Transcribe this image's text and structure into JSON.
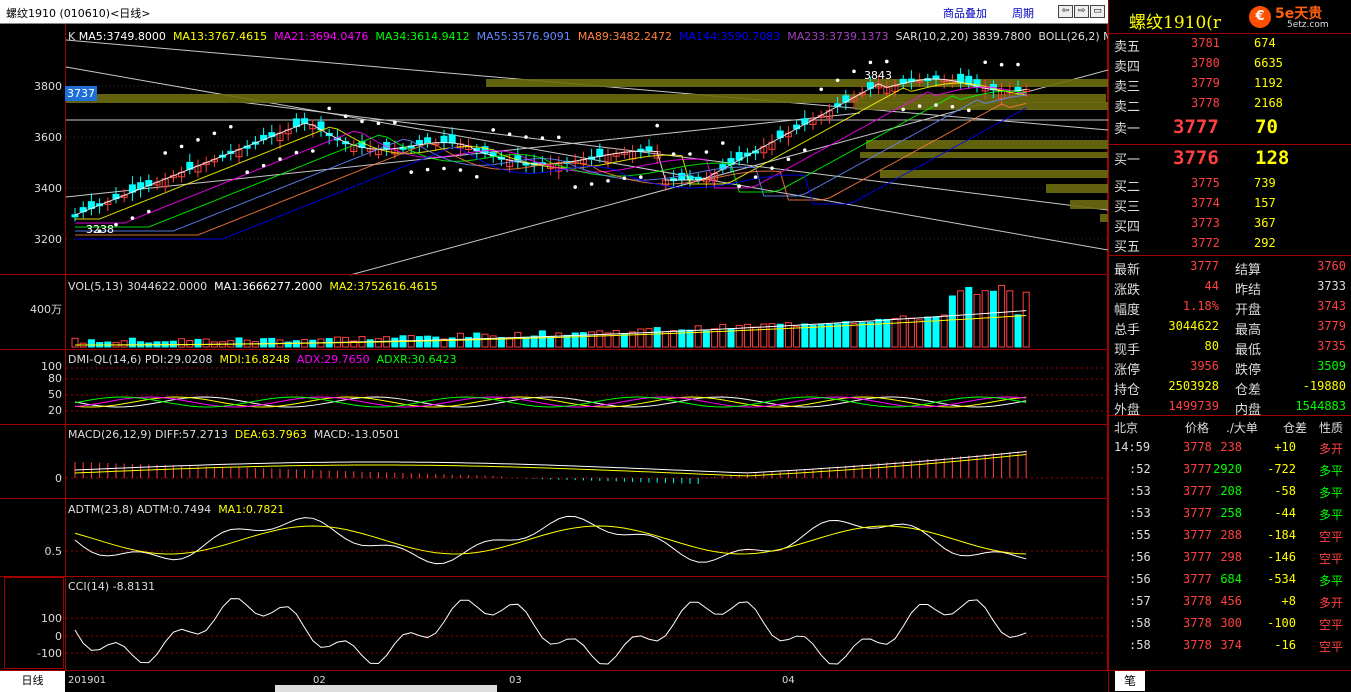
{
  "titlebar": {
    "title": "螺纹1910 (010610)<日线>",
    "overlay_btn": "商品叠加",
    "period_btn": "周期",
    "nav_buttons": [
      "⇦",
      "⇨",
      "▭"
    ]
  },
  "logo": {
    "text": "5e天贵",
    "sub": "5etz.com"
  },
  "main_panel": {
    "label_k": "K",
    "indicators": [
      {
        "text": "MA5:3749.8000",
        "color": "#ffffff"
      },
      {
        "text": "MA13:3767.4615",
        "color": "#ffff00"
      },
      {
        "text": "MA21:3694.0476",
        "color": "#ff00ff"
      },
      {
        "text": "MA34:3614.9412",
        "color": "#00ff00"
      },
      {
        "text": "MA55:3576.9091",
        "color": "#6688ff"
      },
      {
        "text": "MA89:3482.2472",
        "color": "#ff8040"
      },
      {
        "text": "MA144:3590.7083",
        "color": "#0000ff"
      },
      {
        "text": "MA233:3739.1373",
        "color": "#a040c0"
      },
      {
        "text": "SAR(10,2,20)  3839.7800",
        "color": "#dddddd"
      },
      {
        "text": "BOLL(26,2)  M",
        "color": "#dddddd"
      }
    ],
    "y_ticks": [
      "3800",
      "3600",
      "3400",
      "3200"
    ],
    "price_tag": "3737",
    "high_label": "3843",
    "low_label": "3238"
  },
  "vol_panel": {
    "indicators": [
      {
        "text": "VOL(5,13)  3044622.0000",
        "color": "#dddddd"
      },
      {
        "text": "MA1:3666277.2000",
        "color": "#ffffff"
      },
      {
        "text": "MA2:3752616.4615",
        "color": "#ffff00"
      }
    ],
    "y_ticks": [
      "400万"
    ]
  },
  "dmi_panel": {
    "indicators": [
      {
        "text": "DMI-QL(14,6)  PDI:29.0208",
        "color": "#dddddd"
      },
      {
        "text": "MDI:16.8248",
        "color": "#ffff00"
      },
      {
        "text": "ADX:29.7650",
        "color": "#ff00ff"
      },
      {
        "text": "ADXR:30.6423",
        "color": "#00ff00"
      }
    ],
    "y_ticks": [
      "100",
      "80",
      "50",
      "20"
    ]
  },
  "macd_panel": {
    "indicators": [
      {
        "text": "MACD(26,12,9)  DIFF:57.2713",
        "color": "#dddddd"
      },
      {
        "text": "DEA:63.7963",
        "color": "#ffff00"
      },
      {
        "text": "MACD:-13.0501",
        "color": "#dddddd"
      }
    ],
    "y_ticks": [
      "0"
    ]
  },
  "adtm_panel": {
    "indicators": [
      {
        "text": "ADTM(23,8)  ADTM:0.7494",
        "color": "#dddddd"
      },
      {
        "text": "MA1:0.7821",
        "color": "#ffff00"
      }
    ],
    "y_ticks": [
      "0.5"
    ]
  },
  "cci_panel": {
    "indicators": [
      {
        "text": "CCI(14)  -8.8131",
        "color": "#dddddd"
      }
    ],
    "y_ticks": [
      "100",
      "0",
      "-100"
    ]
  },
  "bottombar": {
    "period_tab": "日线",
    "dates": [
      "201901",
      "02",
      "03",
      "04"
    ]
  },
  "quote": {
    "title": "螺纹1910(r",
    "asks": [
      {
        "label": "卖五",
        "price": "3781",
        "vol": "674"
      },
      {
        "label": "卖四",
        "price": "3780",
        "vol": "6635"
      },
      {
        "label": "卖三",
        "price": "3779",
        "vol": "1192"
      },
      {
        "label": "卖二",
        "price": "3778",
        "vol": "2168"
      },
      {
        "label": "卖一",
        "price": "3777",
        "vol": "70"
      }
    ],
    "bids": [
      {
        "label": "买一",
        "price": "3776",
        "vol": "128"
      },
      {
        "label": "买二",
        "price": "3775",
        "vol": "739"
      },
      {
        "label": "买三",
        "price": "3774",
        "vol": "157"
      },
      {
        "label": "买四",
        "price": "3773",
        "vol": "367"
      },
      {
        "label": "买五",
        "price": "3772",
        "vol": "292"
      }
    ],
    "stats": [
      {
        "l1": "最新",
        "v1": "3777",
        "c1": "#ff4040",
        "l2": "结算",
        "v2": "3760",
        "c2": "#ff4040"
      },
      {
        "l1": "涨跌",
        "v1": "44",
        "c1": "#ff4040",
        "l2": "昨结",
        "v2": "3733",
        "c2": "#dddddd"
      },
      {
        "l1": "幅度",
        "v1": "1.18%",
        "c1": "#ff4040",
        "l2": "开盘",
        "v2": "3743",
        "c2": "#ff4040"
      },
      {
        "l1": "总手",
        "v1": "3044622",
        "c1": "#ffff00",
        "l2": "最高",
        "v2": "3779",
        "c2": "#ff4040"
      },
      {
        "l1": "现手",
        "v1": "80",
        "c1": "#ffff00",
        "l2": "最低",
        "v2": "3735",
        "c2": "#ff4040"
      },
      {
        "l1": "涨停",
        "v1": "3956",
        "c1": "#ff4040",
        "l2": "跌停",
        "v2": "3509",
        "c2": "#00ff00"
      },
      {
        "l1": "持仓",
        "v1": "2503928",
        "c1": "#ffff00",
        "l2": "仓差",
        "v2": "-19880",
        "c2": "#ffff00"
      },
      {
        "l1": "外盘",
        "v1": "1499739",
        "c1": "#ff4040",
        "l2": "内盘",
        "v2": "1544883",
        "c2": "#00ff00"
      }
    ],
    "ticks_header": [
      "北京",
      "价格",
      "./大单",
      "仓差",
      "性质"
    ],
    "ticks": [
      {
        "time": "14:59",
        "price": "3778",
        "vol": "238",
        "vc": "#ff4040",
        "oi": "+10",
        "nature": "多开",
        "nc": "#ff4040"
      },
      {
        "time": ":52",
        "price": "3777",
        "vol": "2920",
        "vc": "#00ff00",
        "oi": "-722",
        "nature": "多平",
        "nc": "#00ff00"
      },
      {
        "time": ":53",
        "price": "3777",
        "vol": "208",
        "vc": "#00ff00",
        "oi": "-58",
        "nature": "多平",
        "nc": "#00ff00"
      },
      {
        "time": ":53",
        "price": "3777",
        "vol": "258",
        "vc": "#00ff00",
        "oi": "-44",
        "nature": "多平",
        "nc": "#00ff00"
      },
      {
        "time": ":55",
        "price": "3777",
        "vol": "288",
        "vc": "#ff4040",
        "oi": "-184",
        "nature": "空平",
        "nc": "#ff4040"
      },
      {
        "time": ":56",
        "price": "3777",
        "vol": "298",
        "vc": "#ff4040",
        "oi": "-146",
        "nature": "空平",
        "nc": "#ff4040"
      },
      {
        "time": ":56",
        "price": "3777",
        "vol": "684",
        "vc": "#00ff00",
        "oi": "-534",
        "nature": "多平",
        "nc": "#00ff00"
      },
      {
        "time": ":57",
        "price": "3778",
        "vol": "456",
        "vc": "#ff4040",
        "oi": "+8",
        "nature": "多开",
        "nc": "#ff4040"
      },
      {
        "time": ":58",
        "price": "3778",
        "vol": "300",
        "vc": "#ff4040",
        "oi": "-100",
        "nature": "空平",
        "nc": "#ff4040"
      },
      {
        "time": ":58",
        "price": "3778",
        "vol": "374",
        "vc": "#ff4040",
        "oi": "-16",
        "nature": "空平",
        "nc": "#ff4040"
      }
    ],
    "bottom_tab": "笔"
  },
  "colors": {
    "up": "#ff4040",
    "down": "#00ffff",
    "grid": "#a00000",
    "bg": "#000000"
  }
}
